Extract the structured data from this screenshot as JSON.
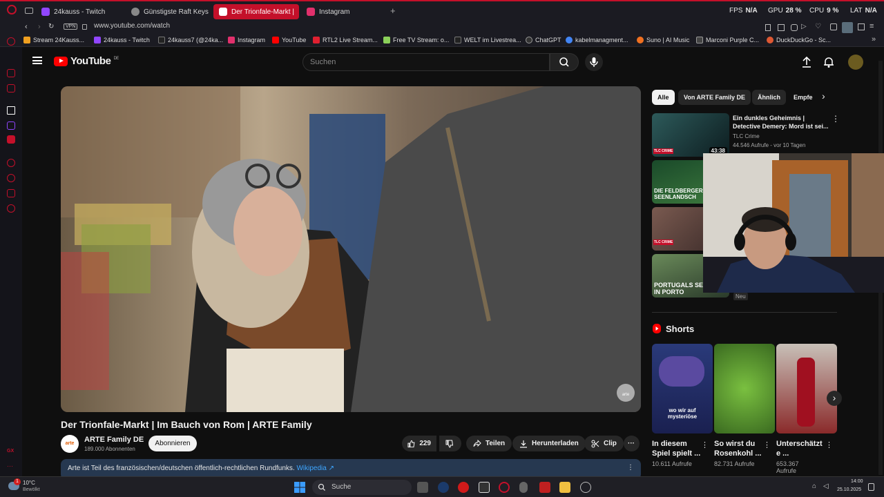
{
  "browser": {
    "tabs": [
      {
        "label": "24kauss - Twitch",
        "active": false
      },
      {
        "label": "Günstigste Raft Keys",
        "active": false
      },
      {
        "label": "Der Trionfale-Markt |",
        "active": true
      },
      {
        "label": "Instagram",
        "active": false
      }
    ],
    "stats": {
      "fps_label": "FPS",
      "fps": "N/A",
      "gpu_label": "GPU",
      "gpu": "28 %",
      "cpu_label": "CPU",
      "cpu": "9 %",
      "lat_label": "LAT",
      "lat": "N/A"
    },
    "vpn": "VPN",
    "url": "www.youtube.com/watch",
    "bookmarks": [
      "Stream 24Kauss...",
      "24kauss - Twitch",
      "24kauss7 (@24ka...",
      "Instagram",
      "YouTube",
      "RTL2 Live Stream...",
      "Free TV Stream: o...",
      "WELT im Livestrea...",
      "ChatGPT",
      "kabelmanagment...",
      "Suno | AI Music",
      "Marconi Purple C...",
      "DuckDuckGo - Sc..."
    ]
  },
  "youtube": {
    "logo": "YouTube",
    "region": "DE",
    "search_placeholder": "Suchen",
    "video": {
      "title": "Der Trionfale-Markt | Im Bauch von Rom | ARTE Family",
      "channel": "ARTE Family DE",
      "subscribers": "189.000 Abonnenten",
      "subscribe": "Abonnieren",
      "likes": "229",
      "share": "Teilen",
      "download": "Herunterladen",
      "clip": "Clip",
      "description": "Arte ist Teil des französischen/deutschen öffentlich-rechtlichen Rundfunks.",
      "description_link": "Wikipedia ↗",
      "channel_watermark": "arte"
    },
    "chips": [
      "Alle",
      "Von ARTE Family DE",
      "Ähnlich",
      "Empfe"
    ],
    "recommended": [
      {
        "title": "Ein dunkles Geheimnis | Detective Demery: Mord ist sei...",
        "channel": "TLC Crime",
        "meta": "44.546 Aufrufe - vor 10 Tagen",
        "duration": "43:38",
        "badge": "TLC CRIME"
      },
      {
        "title": "",
        "overlay": "DIE FELDBERGER SEENLANDSCH"
      },
      {
        "title": "",
        "badge": "TLC CRIME"
      },
      {
        "title": "",
        "overlay": "PORTUGALS SEELE IN PORTO",
        "tag": "Neu"
      }
    ],
    "shorts_heading": "Shorts",
    "shorts": [
      {
        "title": "In diesem Spiel spielt ...",
        "views": "10.611 Aufrufe",
        "overlay": "wo wir auf mysteriöse"
      },
      {
        "title": "So wirst du Rosenkohl ...",
        "views": "82.731 Aufrufe"
      },
      {
        "title": "Unterschätzt e ...",
        "views": "653.367 Aufrufe"
      }
    ]
  },
  "taskbar": {
    "weather_temp": "10°C",
    "weather_desc": "Bewölkt",
    "weather_badge": "1",
    "search": "Suche",
    "time": "14:00",
    "date": "25.10.2025"
  },
  "colors": {
    "opera_red": "#c4102a",
    "yt_red": "#ff0000",
    "link_blue": "#3ea6ff",
    "desc_bg": "#263850"
  }
}
